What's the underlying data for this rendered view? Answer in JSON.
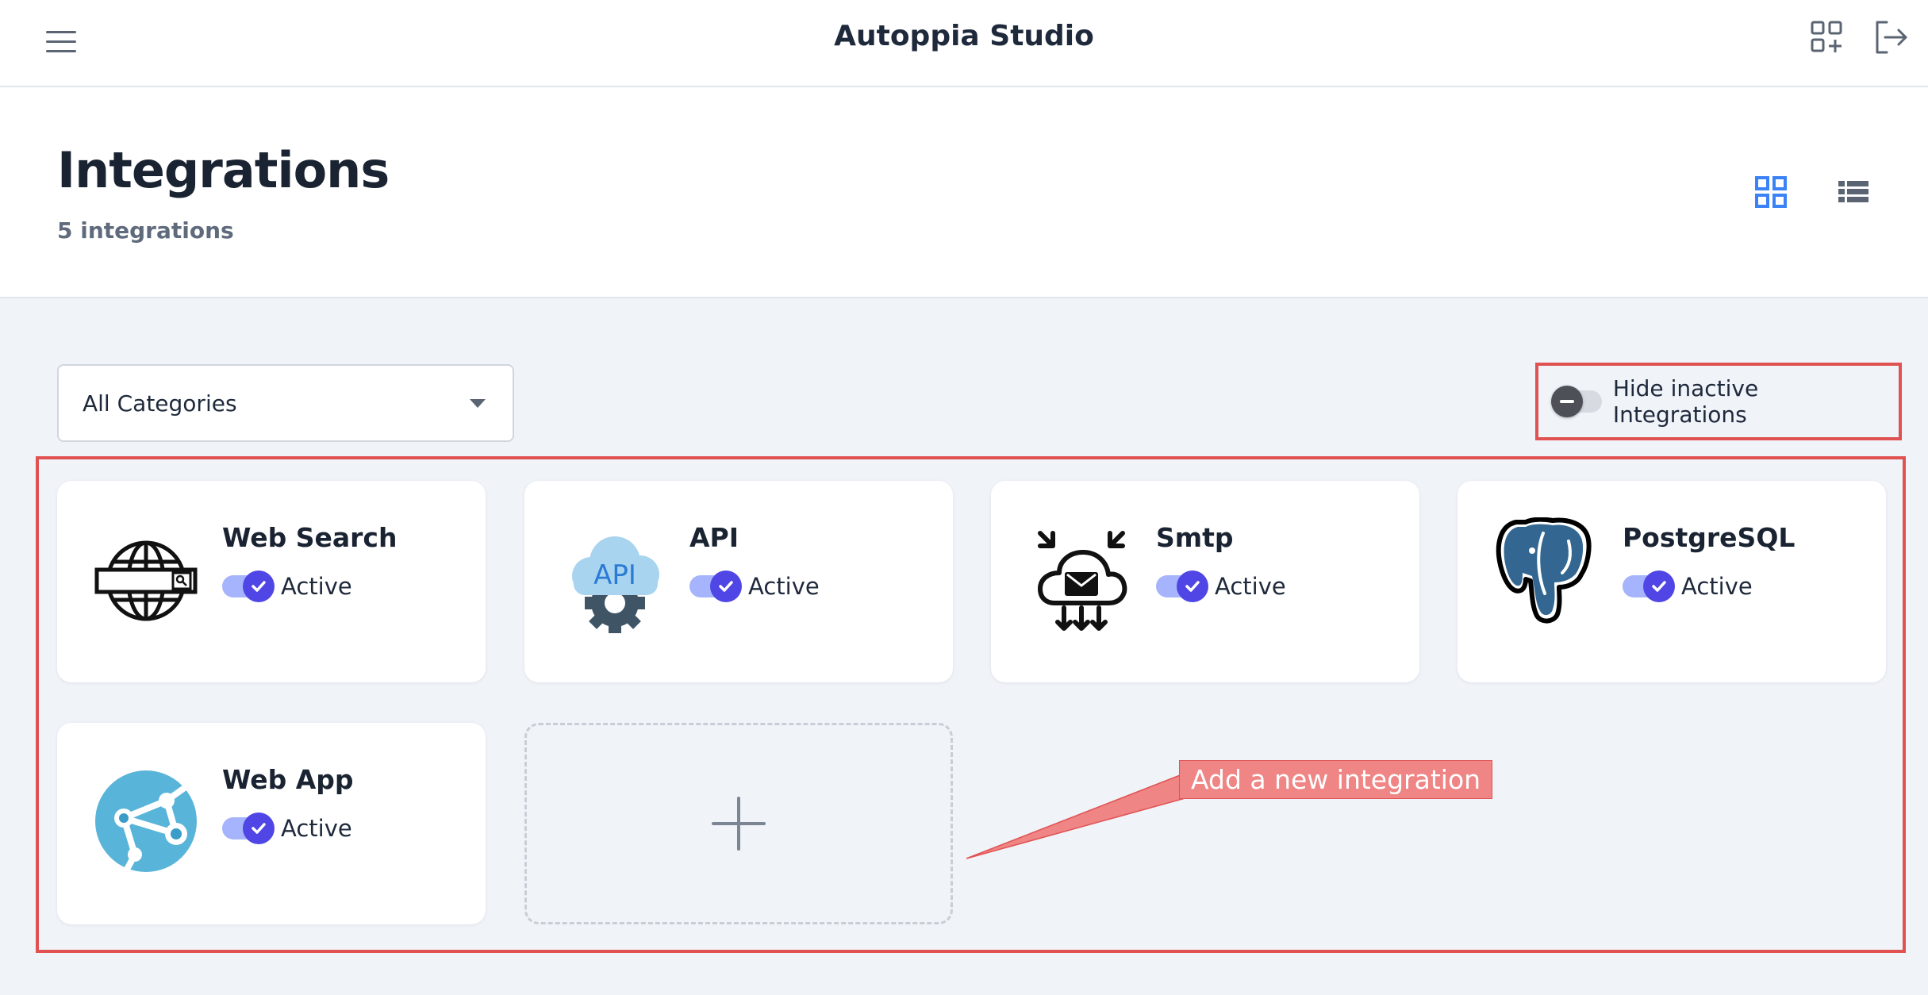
{
  "app": {
    "title": "Autoppia Studio"
  },
  "topbar": {
    "menu_icon": "hamburger-menu-icon",
    "apps_icon": "add-app-grid-icon",
    "logout_icon": "logout-icon"
  },
  "page": {
    "title": "Integrations",
    "count": "5 integrations"
  },
  "view_toggle": {
    "grid_icon": "grid-view-icon",
    "list_icon": "list-view-icon",
    "active": "grid",
    "active_color": "#3b82f6"
  },
  "filter": {
    "category_selected": "All Categories"
  },
  "hide_inactive": {
    "label": "Hide inactive Integrations",
    "enabled": false
  },
  "integrations": [
    {
      "name": "Web Search",
      "status": "Active",
      "active": true,
      "icon": "web-search-globe-icon"
    },
    {
      "name": "API",
      "status": "Active",
      "active": true,
      "icon": "api-cloud-gear-icon"
    },
    {
      "name": "Smtp",
      "status": "Active",
      "active": true,
      "icon": "smtp-cloud-mail-icon"
    },
    {
      "name": "PostgreSQL",
      "status": "Active",
      "active": true,
      "icon": "postgresql-elephant-icon"
    },
    {
      "name": "Web App",
      "status": "Active",
      "active": true,
      "icon": "web-app-globe-icon"
    }
  ],
  "add_card": {
    "icon": "plus-icon"
  },
  "annotation": {
    "text": "Add a new integration",
    "color": "#e05252"
  },
  "colors": {
    "accent": "#4f46e5",
    "toggle_track": "#a5b4fc",
    "highlight": "#e05252",
    "background": "#f0f3f8"
  }
}
